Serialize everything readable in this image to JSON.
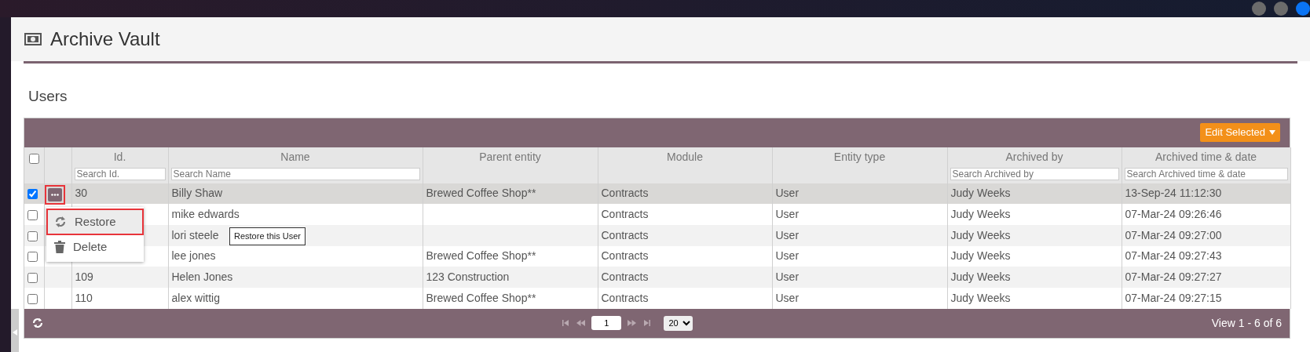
{
  "page": {
    "title": "Archive Vault"
  },
  "section": {
    "title": "Users"
  },
  "toolbar": {
    "edit_button": "Edit Selected"
  },
  "table": {
    "all_checked": false,
    "columns": [
      {
        "label": "Id.",
        "placeholder": "Search Id."
      },
      {
        "label": "Name",
        "placeholder": "Search Name"
      },
      {
        "label": "Parent entity"
      },
      {
        "label": "Module"
      },
      {
        "label": "Entity type"
      },
      {
        "label": "Archived by",
        "placeholder": "Search Archived by"
      },
      {
        "label": "Archived time & date",
        "placeholder": "Search Archived time & date"
      }
    ],
    "rows": [
      {
        "selected": true,
        "checked": true,
        "menu_open": true,
        "cells": [
          "30",
          "Billy Shaw",
          "Brewed Coffee Shop**",
          "Contracts",
          "User",
          "Judy Weeks",
          "13-Sep-24 11:12:30"
        ]
      },
      {
        "selected": false,
        "checked": false,
        "menu_open": false,
        "cells": [
          null,
          "mike edwards",
          null,
          "Contracts",
          "User",
          "Judy Weeks",
          "07-Mar-24 09:26:46"
        ]
      },
      {
        "selected": false,
        "checked": false,
        "menu_open": false,
        "cells": [
          null,
          "lori steele",
          null,
          "Contracts",
          "User",
          "Judy Weeks",
          "07-Mar-24 09:27:00"
        ]
      },
      {
        "selected": false,
        "checked": false,
        "menu_open": false,
        "cells": [
          null,
          "lee jones",
          "Brewed Coffee Shop**",
          "Contracts",
          "User",
          "Judy Weeks",
          "07-Mar-24 09:27:43"
        ]
      },
      {
        "selected": false,
        "checked": false,
        "menu_open": false,
        "cells": [
          "109",
          "Helen Jones",
          "123 Construction",
          "Contracts",
          "User",
          "Judy Weeks",
          "07-Mar-24 09:27:27"
        ]
      },
      {
        "selected": false,
        "checked": false,
        "menu_open": false,
        "cells": [
          "110",
          "alex wittig",
          "Brewed Coffee Shop**",
          "Contracts",
          "User",
          "Judy Weeks",
          "07-Mar-24 09:27:15"
        ]
      }
    ]
  },
  "context_menu": {
    "items": [
      {
        "kind": "restore",
        "label": "Restore",
        "highlighted": true
      },
      {
        "kind": "delete",
        "label": "Delete",
        "highlighted": false
      }
    ]
  },
  "tooltip": {
    "text": "Restore this User"
  },
  "pager": {
    "page": "1",
    "page_size": "20",
    "summary": "View 1 - 6 of 6"
  }
}
